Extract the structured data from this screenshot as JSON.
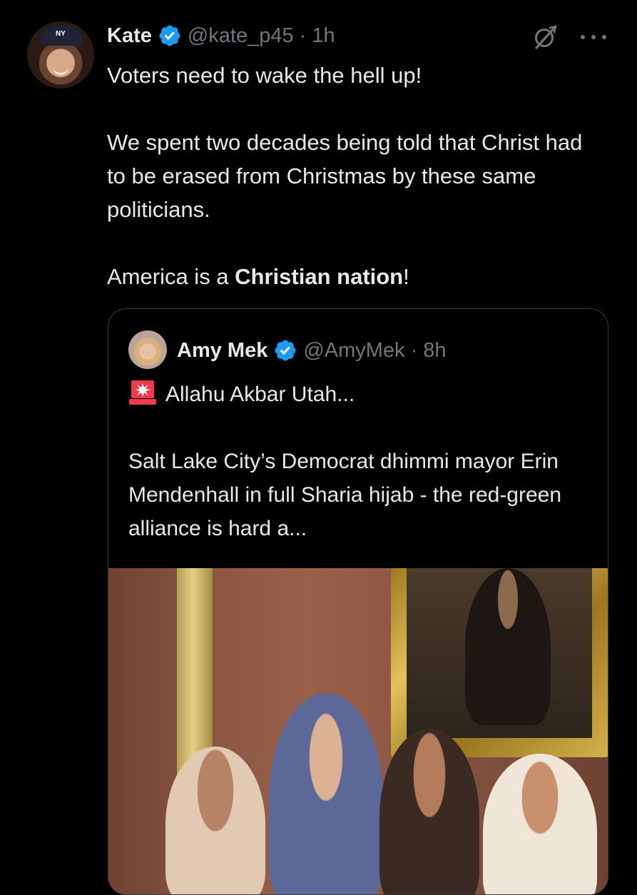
{
  "colors": {
    "background": "#000000",
    "primary_text": "#e7e9ea",
    "secondary_text": "#71767b",
    "verified_blue": "#1d9bf0",
    "border": "#3a3d41"
  },
  "tweet": {
    "author_name": "Kate",
    "handle": "@kate_p45",
    "separator": "·",
    "time": "1h",
    "avatar_icon": "user-avatar",
    "verified_icon": "verified-badge-icon",
    "grok_icon": "grok-icon",
    "more_icon": "more-options-icon",
    "text": {
      "line1": "Voters need to wake the hell up!",
      "line2": "We spent two decades being told that Christ had to be erased from Christmas by these same politicians.",
      "line3_prefix": "America is a ",
      "line3_bold": "Christian nation",
      "line3_suffix": "!"
    }
  },
  "quoted_tweet": {
    "author_name": "Amy Mek",
    "handle": "@AmyMek",
    "separator": "·",
    "time": "8h",
    "siren_icon": "police-siren-emoji",
    "text": {
      "line1": "Allahu Akbar Utah...",
      "line2": "Salt Lake City’s Democrat dhimmi mayor Erin Mendenhall in full Sharia hijab -  the red-green alliance is hard a..."
    },
    "photo": "group-photo"
  }
}
